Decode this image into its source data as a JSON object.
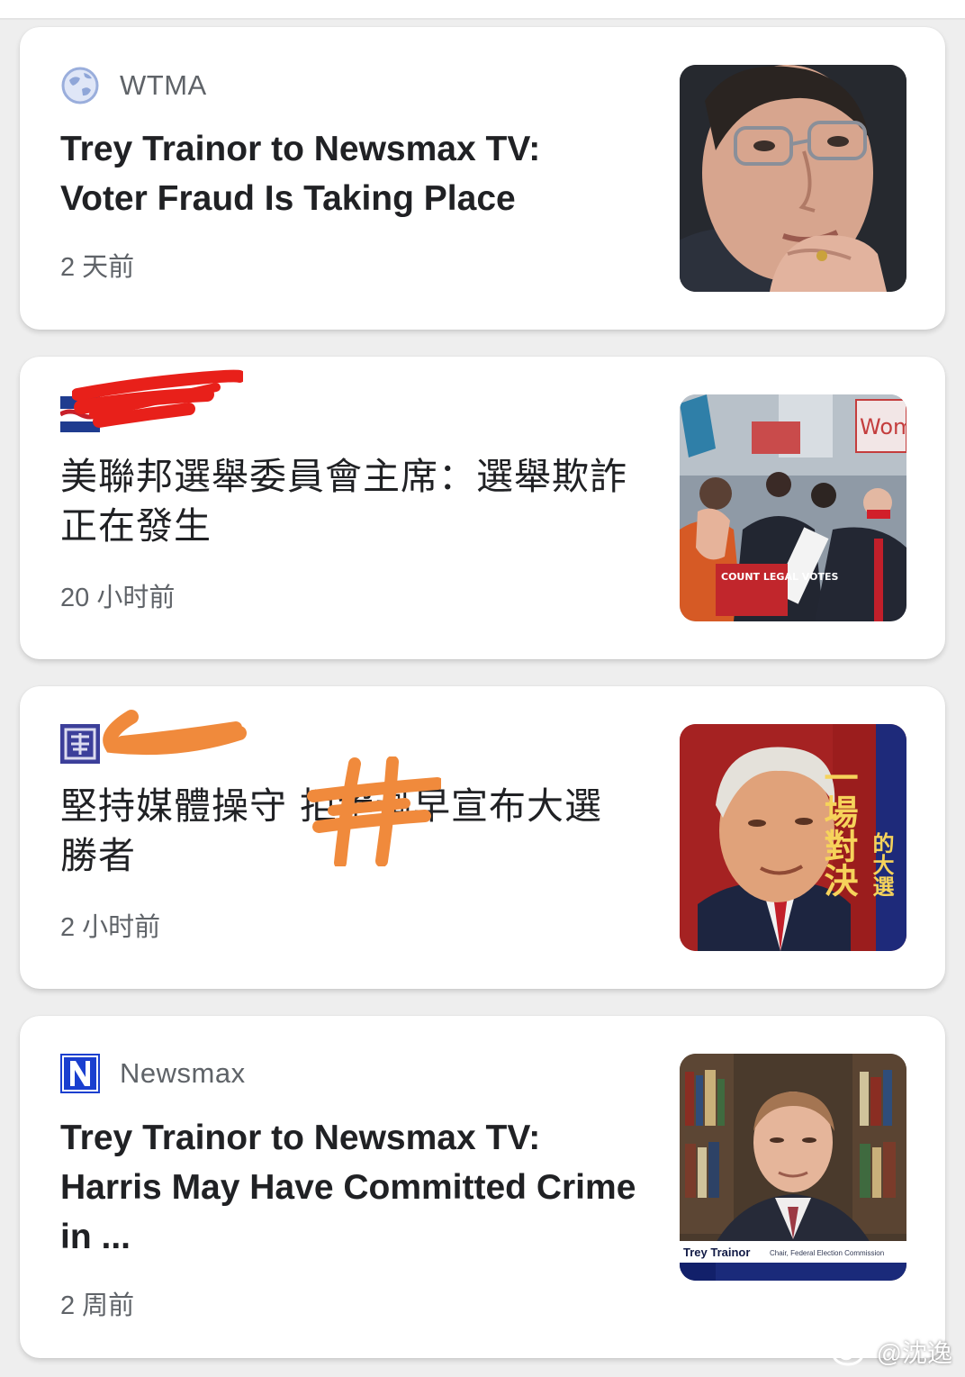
{
  "feed": {
    "cards": [
      {
        "source": "WTMA",
        "source_icon": "globe-icon",
        "headline": "Trey Trainor to Newsmax TV: Voter Fraud Is Taking Place",
        "time": "2 天前",
        "thumbnail": "portrait-thumbnail"
      },
      {
        "source": "",
        "source_icon": "flag-logo-icon",
        "headline": "美聯邦選舉委員會主席：選舉欺詐正在發生",
        "time": "20 小时前",
        "thumbnail": "protest-thumbnail"
      },
      {
        "source": "",
        "source_icon": "emblem-logo-icon",
        "headline": "堅持媒體操守 拒絕過早宣布大選勝者",
        "time": "2 小时前",
        "thumbnail": "trump-thumbnail"
      },
      {
        "source": "Newsmax",
        "source_icon": "newsmax-n-icon",
        "headline": "Trey Trainor to Newsmax TV: Harris May Have Committed Crime in ...",
        "time": "2 周前",
        "thumbnail": "interview-thumbnail"
      }
    ]
  },
  "thumbnails": {
    "protest_sign_top": "Wom",
    "protest_sign_bottom": "COUNT LEGAL VOTES",
    "trump_banner": "一場對決",
    "trump_banner_small": "的大選",
    "interview_name": "Trey Trainor",
    "interview_title": "Chair, Federal Election Commission"
  },
  "watermark": {
    "text": "@沈逸"
  },
  "colors": {
    "card_bg": "#ffffff",
    "page_bg": "#eeeeee",
    "headline": "#202124",
    "meta": "#5f6368",
    "red_scribble": "#e8201a",
    "orange_scribble": "#f08a3c",
    "newsmax_blue": "#1a3fcf"
  }
}
